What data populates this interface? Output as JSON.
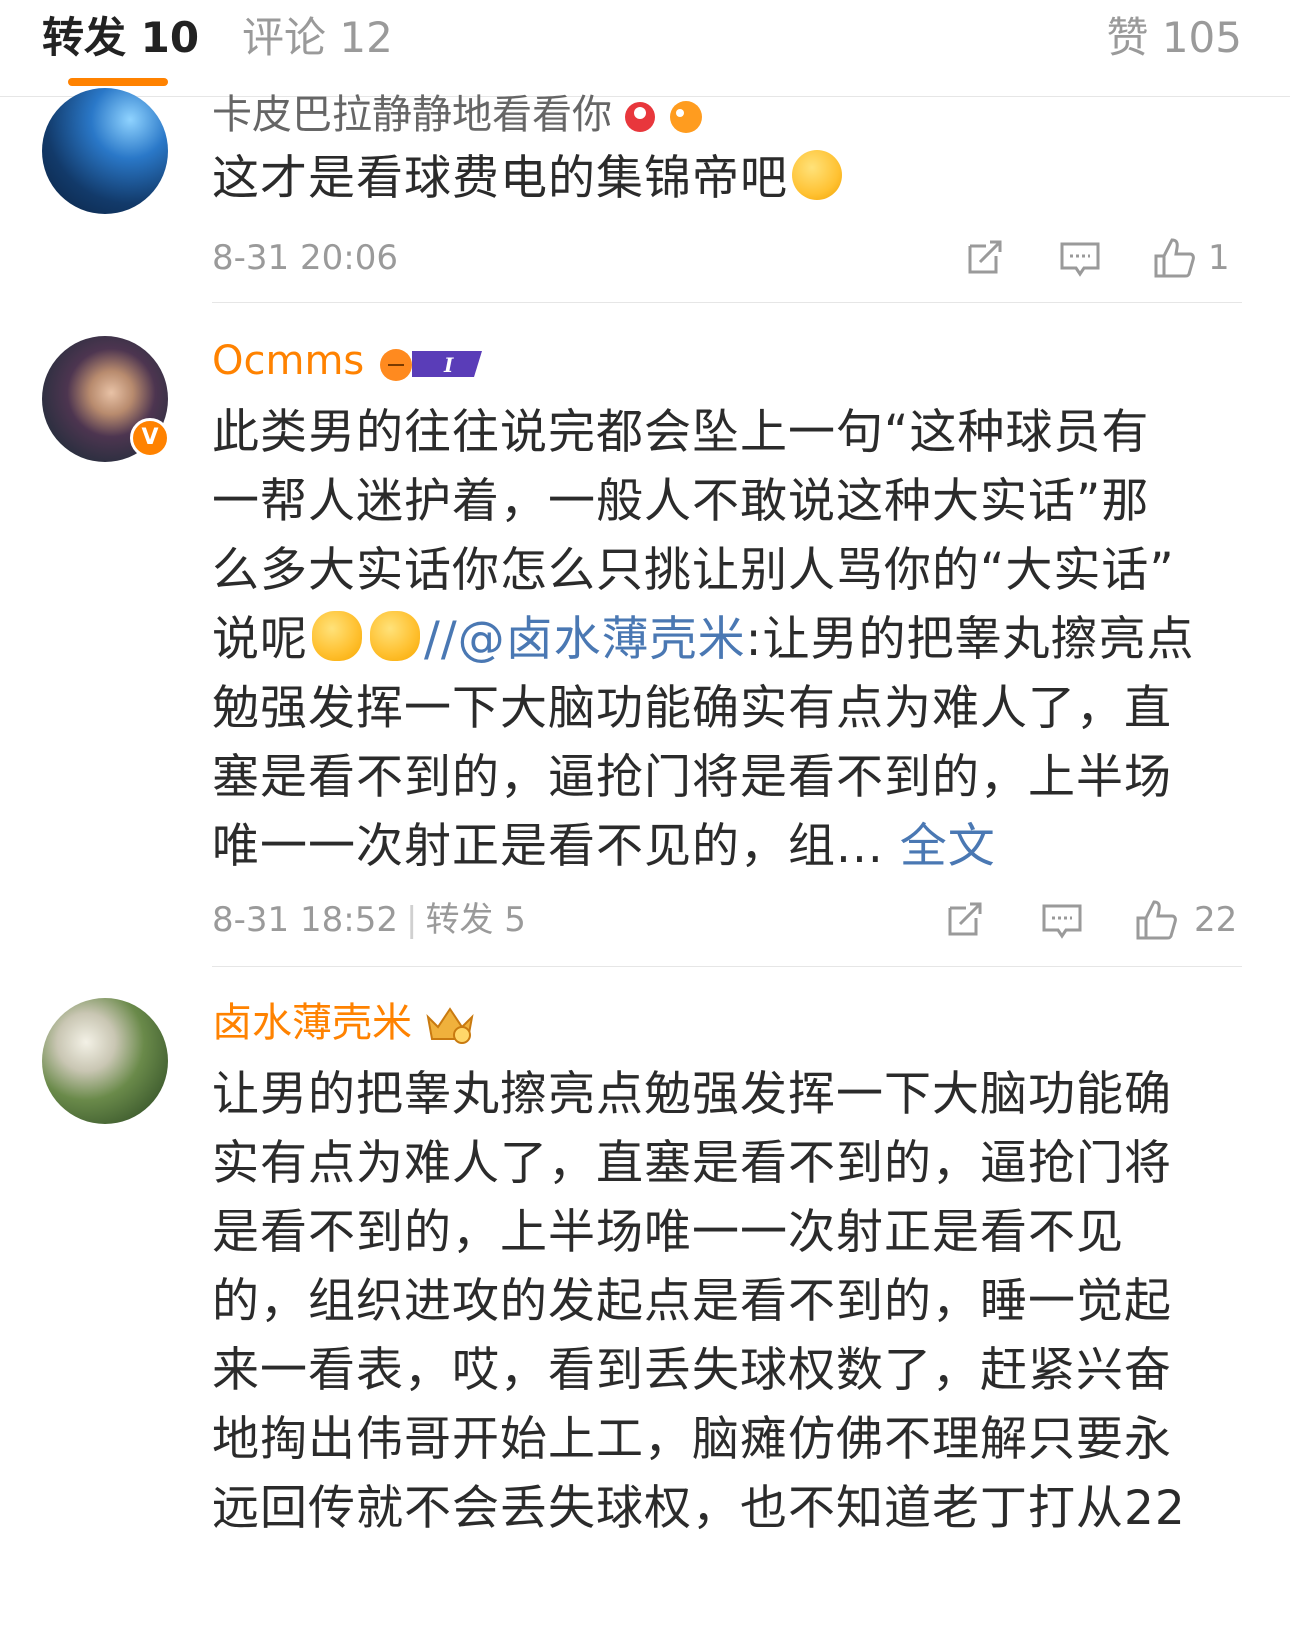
{
  "tabs": {
    "repost": "转发 10",
    "comment": "评论 12",
    "like": "赞 105"
  },
  "comments": [
    {
      "author": "卡皮巴拉静静地看看你",
      "lines": [
        "这才是看球费电的集锦帝吧"
      ],
      "time": "8-31 20:06",
      "likes": "1"
    },
    {
      "author": "Ocmms",
      "lines": [
        "此类男的往往说完都会坠上一句“这种球员有",
        "一帮人迷护着，一般人不敢说这种大实话”那",
        "么多大实话你怎么只挑让别人骂你的“大实话”",
        "说呢"
      ],
      "line4_mention": "//@卤水薄壳米",
      "line4_rest": ":让男的把睾丸擦亮点",
      "lines_after": [
        "勉强发挥一下大脑功能确实有点为难人了，直",
        "塞是看不到的，逼抢门将是看不到的，上半场"
      ],
      "last_line": "唯一一次射正是看不见的，组...",
      "full_text": "全文",
      "time": "8-31 18:52",
      "repost": "转发 5",
      "likes": "22"
    },
    {
      "author": "卤水薄壳米",
      "lines": [
        "让男的把睾丸擦亮点勉强发挥一下大脑功能确",
        "实有点为难人了，直塞是看不到的，逼抢门将",
        "是看不到的，上半场唯一一次射正是看不见",
        "的，组织进攻的发起点是看不到的，睡一觉起",
        "来一看表，哎，看到丢失球权数了，赶紧兴奋",
        "地掏出伟哥开始上工，脑瘫仿佛不理解只要永",
        "远回传就不会丢失球权，也不知道老丁打从22"
      ]
    }
  ],
  "colors": {
    "accent": "#ff8200",
    "link": "#4a78b3",
    "meta": "#9a9a9a"
  },
  "icons": [
    "repost-icon",
    "comment-icon",
    "like-icon",
    "verified-icon"
  ]
}
